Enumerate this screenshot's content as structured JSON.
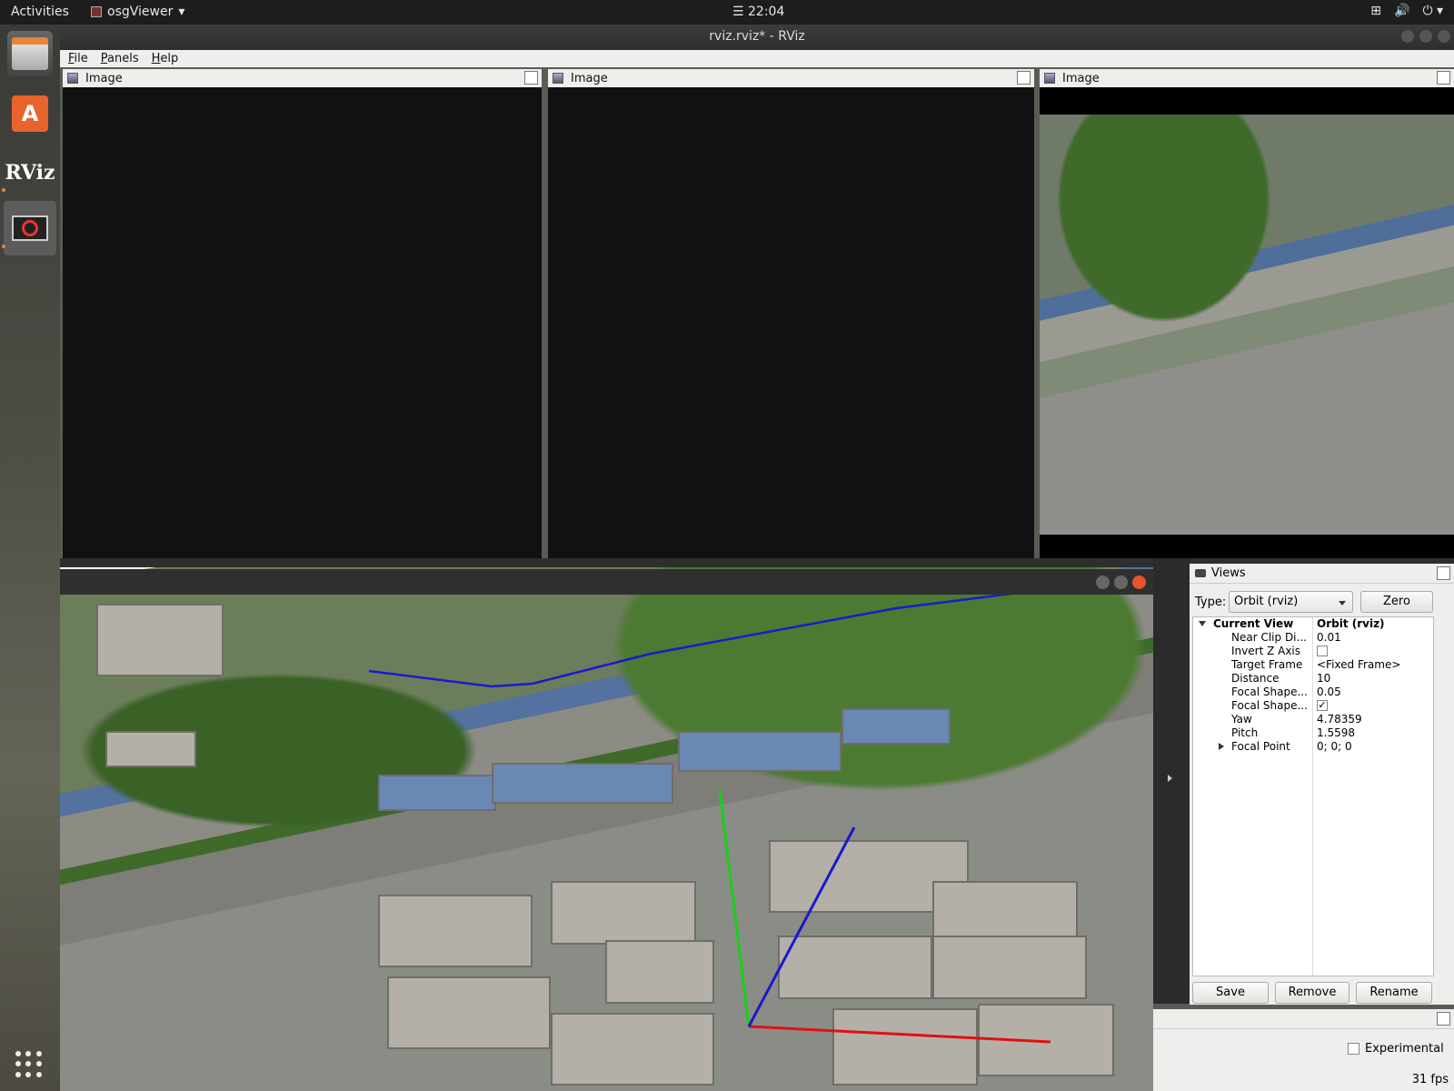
{
  "topbar": {
    "activities": "Activities",
    "app_name": "osgViewer",
    "clock": "☰ 22:04",
    "tray": [
      "⊞",
      "🔊",
      "⏻ ▾"
    ]
  },
  "dock": {
    "rviz_label": "RViz"
  },
  "window": {
    "title": "rviz.rviz* - RViz"
  },
  "menu": {
    "file": "File",
    "panels": "Panels",
    "help": "Help"
  },
  "image_panels": [
    {
      "title": "Image"
    },
    {
      "title": "Image"
    },
    {
      "title": "Image"
    }
  ],
  "views": {
    "title": "Views",
    "type_label": "Type:",
    "type_value": "Orbit (rviz)",
    "zero": "Zero",
    "tree": {
      "header_key": "Current View",
      "header_val": "Orbit (rviz)",
      "rows": [
        {
          "k": "Near Clip Di...",
          "v": "0.01"
        },
        {
          "k": "Invert Z Axis",
          "v": ""
        },
        {
          "k": "Target Frame",
          "v": "<Fixed Frame>"
        },
        {
          "k": "Distance",
          "v": "10"
        },
        {
          "k": "Focal Shape...",
          "v": "0.05"
        },
        {
          "k": "Focal Shape...",
          "v": "✓"
        },
        {
          "k": "Yaw",
          "v": "4.78359"
        },
        {
          "k": "Pitch",
          "v": "1.5598"
        },
        {
          "k": "Focal Point",
          "v": "0; 0; 0"
        }
      ]
    },
    "save": "Save",
    "remove": "Remove",
    "rename": "Rename"
  },
  "bottom": {
    "experimental": "Experimental",
    "fps": "31 fps"
  }
}
